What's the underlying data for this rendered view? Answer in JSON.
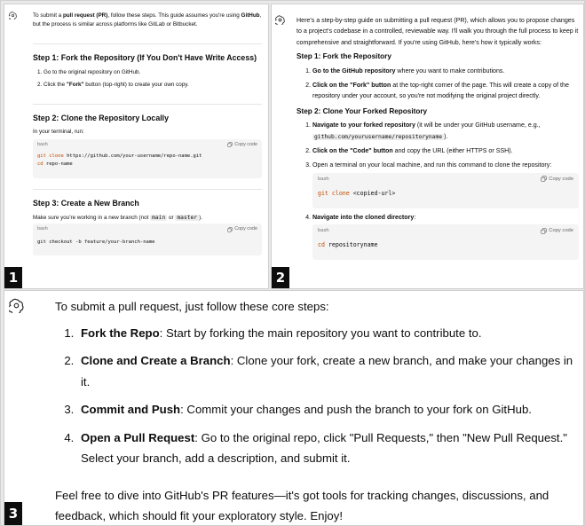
{
  "panel1": {
    "badge": "1",
    "intro_a": "To submit a ",
    "intro_b": "pull request (PR)",
    "intro_c": ", follow these steps. This guide assumes you're using ",
    "intro_d": "GitHub",
    "intro_e": ", but the process is similar across platforms like GitLab or Bitbucket.",
    "step1_heading": "Step 1: Fork the Repository (If You Don't Have Write Access)",
    "step1_item1": "Go to the original repository on GitHub.",
    "step1_item2_a": "Click the ",
    "step1_item2_b": "\"Fork\"",
    "step1_item2_c": " button (top-right) to create your own copy.",
    "step2_heading": "Step 2: Clone the Repository Locally",
    "step2_text": "In your terminal, run:",
    "code1_lang": "bash",
    "code1_copy": "Copy code",
    "code1_line1_kw": "git clone",
    "code1_line1_rest": " https://github.com/your-username/repo-name.git",
    "code1_line2_kw": "cd",
    "code1_line2_rest": " repo-name",
    "step3_heading": "Step 3: Create a New Branch",
    "step3_text_a": "Make sure you're working in a new branch (not ",
    "step3_code_a": "main",
    "step3_text_b": " or ",
    "step3_code_b": "master",
    "step3_text_c": ").",
    "code2_lang": "bash",
    "code2_copy": "Copy code",
    "code2_line1": "git checkout -b feature/your-branch-name"
  },
  "panel2": {
    "badge": "2",
    "intro": "Here's a step-by-step guide on submitting a pull request (PR), which allows you to propose changes to a project's codebase in a controlled, reviewable way. I'll walk you through the full process to keep it comprehensive and straightforward. If you're using GitHub, here's how it typically works:",
    "step1_heading": "Step 1: Fork the Repository",
    "s1_item1_b": "Go to the GitHub repository",
    "s1_item1_c": " where you want to make contributions.",
    "s1_item2_b": "Click on the \"Fork\" button",
    "s1_item2_c": " at the top-right corner of the page. This will create a copy of the repository under your account, so you're not modifying the original project directly.",
    "step2_heading": "Step 2: Clone Your Forked Repository",
    "s2_item1_b": "Navigate to your forked repository",
    "s2_item1_c": " (it will be under your GitHub username, e.g., ",
    "s2_item1_code": "github.com/yourusername/repositoryname",
    "s2_item1_d": ").",
    "s2_item2_b": "Click on the \"Code\" button",
    "s2_item2_c": " and copy the URL (either HTTPS or SSH).",
    "s2_item3": "Open a terminal on your local machine, and run this command to clone the repository:",
    "code1_lang": "bash",
    "code1_copy": "Copy code",
    "code1_kw": "git clone",
    "code1_rest": " <copied-url>",
    "s2_item4_b": "Navigate into the cloned directory",
    "s2_item4_c": ":",
    "code2_lang": "bash",
    "code2_copy": "Copy code",
    "code2_kw": "cd",
    "code2_rest": " repositoryname"
  },
  "panel3": {
    "badge": "3",
    "intro": "To submit a pull request, just follow these core steps:",
    "item1_b": "Fork the Repo",
    "item1_c": ": Start by forking the main repository you want to contribute to.",
    "item2_b": "Clone and Create a Branch",
    "item2_c": ": Clone your fork, create a new branch, and make your changes in it.",
    "item3_b": "Commit and Push",
    "item3_c": ": Commit your changes and push the branch to your fork on GitHub.",
    "item4_b": "Open a Pull Request",
    "item4_c": ": Go to the original repo, click \"Pull Requests,\" then \"New Pull Request.\" Select your branch, add a description, and submit it.",
    "outro": "Feel free to dive into GitHub's PR features—it's got tools for tracking changes, discussions, and feedback, which should fit your exploratory style. Enjoy!"
  },
  "icons": {
    "assistant": "openai-logo-icon",
    "copy": "copy-icon"
  },
  "colors": {
    "keyword": "#c24a00",
    "code_bg": "#f4f4f4",
    "badge_bg": "#0d0d0d"
  }
}
